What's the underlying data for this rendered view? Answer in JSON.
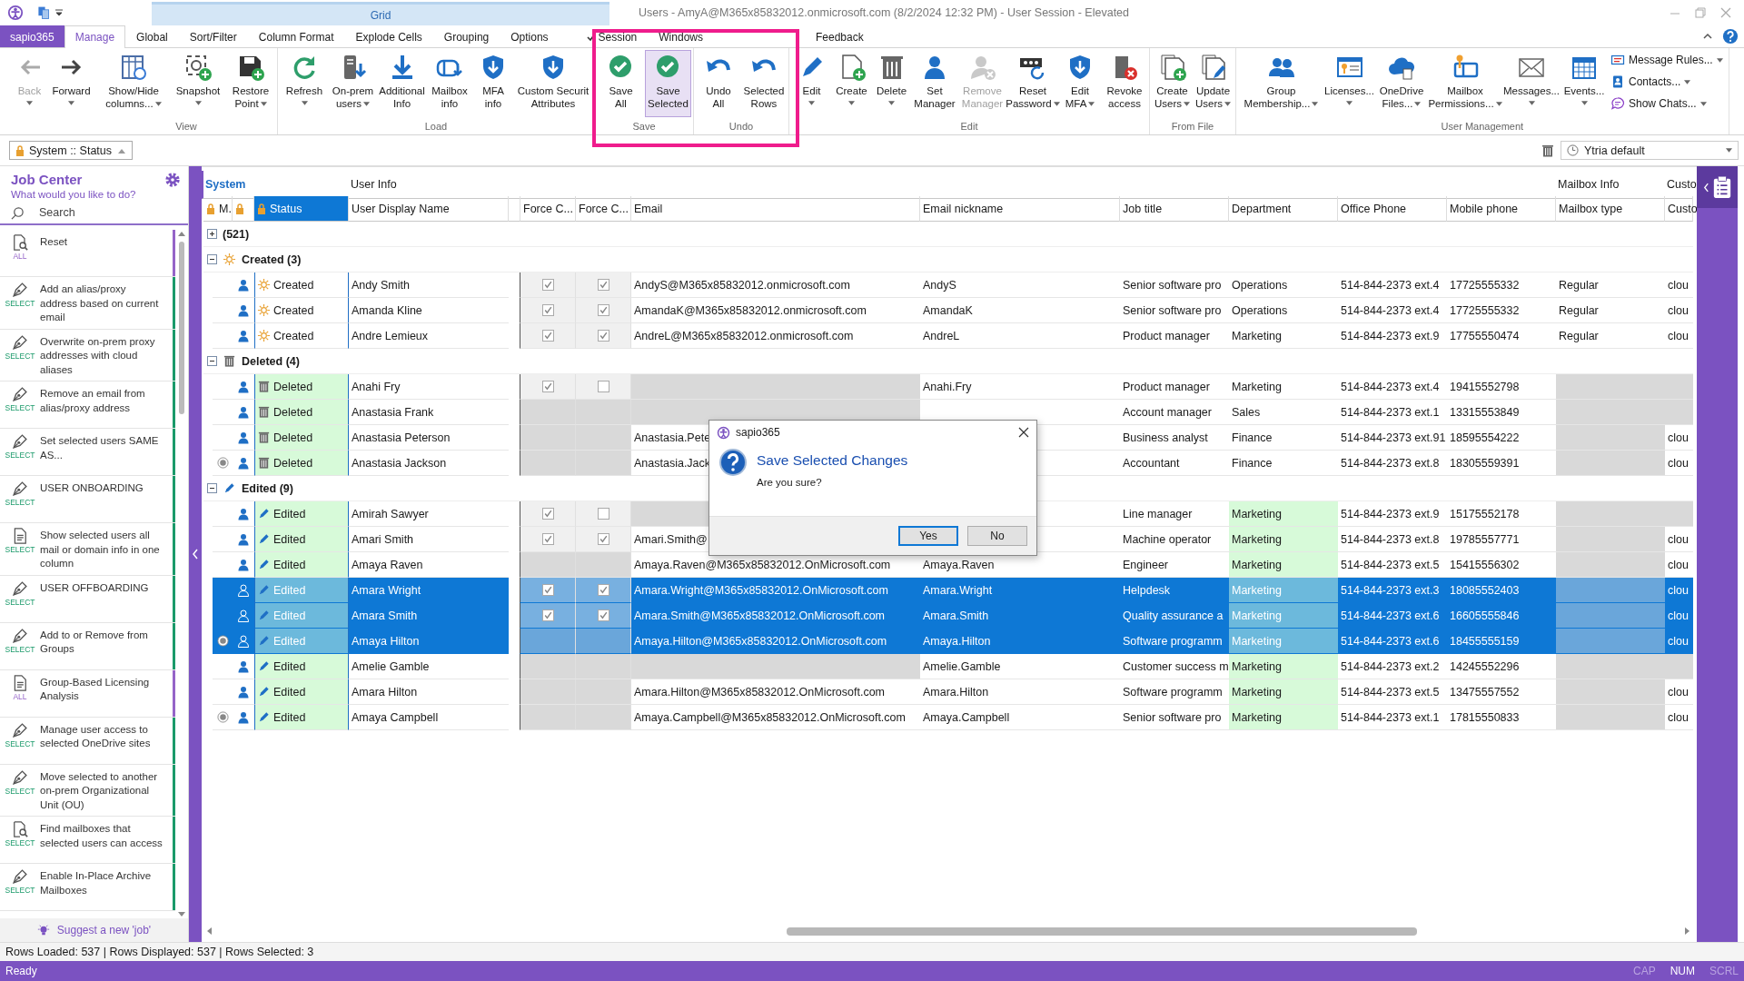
{
  "window": {
    "title": "Users - AmyA@M365x85832012.onmicrosoft.com (8/2/2024 12:32 PM) - User Session - Elevated",
    "context_tab": "Grid"
  },
  "tabs": [
    {
      "label": "sapio365",
      "kind": "app",
      "selected": false,
      "checked": false
    },
    {
      "label": "Manage",
      "kind": "tab",
      "selected": true,
      "checked": false
    },
    {
      "label": "Global",
      "kind": "tab",
      "selected": false,
      "checked": false
    },
    {
      "label": "Sort/Filter",
      "kind": "tab",
      "selected": false,
      "checked": false
    },
    {
      "label": "Column Format",
      "kind": "tab",
      "selected": false,
      "checked": false
    },
    {
      "label": "Explode Cells",
      "kind": "tab",
      "selected": false,
      "checked": false
    },
    {
      "label": "Grouping",
      "kind": "tab",
      "selected": false,
      "checked": false
    },
    {
      "label": "Options",
      "kind": "tab",
      "selected": false,
      "checked": false
    },
    {
      "label": "Session",
      "kind": "tab",
      "selected": false,
      "checked": true
    },
    {
      "label": "Windows",
      "kind": "tab",
      "selected": false,
      "checked": false
    },
    {
      "label": "Feedback",
      "kind": "tab",
      "selected": false,
      "checked": false
    }
  ],
  "highlight_frame": true,
  "ribbon": {
    "groups": [
      {
        "buttons": [
          {
            "lines": [
              "Back"
            ],
            "kind": "split",
            "disabled": true,
            "selected": false
          },
          {
            "lines": [
              "Forward"
            ],
            "kind": "split",
            "disabled": false,
            "selected": false
          }
        ]
      },
      {
        "label": "View",
        "buttons": [
          {
            "lines": [
              "Show/Hide",
              "columns..."
            ],
            "kind": "menu",
            "disabled": false,
            "selected": false
          },
          {
            "lines": [
              "Snapshot"
            ],
            "kind": "split",
            "disabled": false,
            "selected": false
          },
          {
            "lines": [
              "Restore",
              "Point"
            ],
            "kind": "menu",
            "disabled": false,
            "selected": false
          }
        ]
      },
      {
        "label": "Load",
        "buttons": [
          {
            "lines": [
              "Refresh"
            ],
            "kind": "split",
            "disabled": false,
            "selected": false
          },
          {
            "lines": [
              "On-prem",
              "users"
            ],
            "kind": "menu",
            "disabled": false,
            "selected": false
          },
          {
            "lines": [
              "Additional",
              "Info"
            ],
            "kind": "plain",
            "disabled": false,
            "selected": false
          },
          {
            "lines": [
              "Mailbox",
              "info"
            ],
            "kind": "plain",
            "disabled": false,
            "selected": false
          },
          {
            "lines": [
              "MFA",
              "info"
            ],
            "kind": "plain",
            "disabled": false,
            "selected": false
          },
          {
            "lines": [
              "Custom Securit",
              "Attributes"
            ],
            "kind": "plain",
            "disabled": false,
            "selected": false
          }
        ]
      },
      {
        "label": "Save",
        "buttons": [
          {
            "lines": [
              "Save",
              "All"
            ],
            "kind": "plain",
            "disabled": false,
            "selected": false
          },
          {
            "lines": [
              "Save",
              "Selected"
            ],
            "kind": "plain",
            "disabled": false,
            "selected": true
          }
        ]
      },
      {
        "label": "Undo",
        "buttons": [
          {
            "lines": [
              "Undo",
              "All"
            ],
            "kind": "plain",
            "disabled": false,
            "selected": false
          },
          {
            "lines": [
              "Selected",
              "Rows"
            ],
            "kind": "plain",
            "disabled": false,
            "selected": false
          }
        ]
      },
      {
        "label": "Edit",
        "buttons": [
          {
            "lines": [
              "Edit"
            ],
            "kind": "split",
            "disabled": false,
            "selected": false
          },
          {
            "lines": [
              "Create"
            ],
            "kind": "split",
            "disabled": false,
            "selected": false
          },
          {
            "lines": [
              "Delete"
            ],
            "kind": "split",
            "disabled": false,
            "selected": false
          },
          {
            "lines": [
              "Set",
              "Manager"
            ],
            "kind": "plain",
            "disabled": false,
            "selected": false
          },
          {
            "lines": [
              "Remove",
              "Manager"
            ],
            "kind": "plain",
            "disabled": true,
            "selected": false
          },
          {
            "lines": [
              "Reset",
              "Password"
            ],
            "kind": "menu",
            "disabled": false,
            "selected": false
          },
          {
            "lines": [
              "Edit",
              "MFA"
            ],
            "kind": "menu",
            "disabled": false,
            "selected": false
          },
          {
            "lines": [
              "Revoke",
              "access"
            ],
            "kind": "plain",
            "disabled": false,
            "selected": false
          }
        ]
      },
      {
        "label": "From File",
        "buttons": [
          {
            "lines": [
              "Create",
              "Users"
            ],
            "kind": "menu",
            "disabled": false,
            "selected": false
          },
          {
            "lines": [
              "Update",
              "Users"
            ],
            "kind": "menu",
            "disabled": false,
            "selected": false
          }
        ]
      },
      {
        "label": "User Management",
        "buttons": [
          {
            "lines": [
              "Group",
              "Membership..."
            ],
            "kind": "menu",
            "disabled": false,
            "selected": false
          },
          {
            "lines": [
              "Licenses..."
            ],
            "kind": "split",
            "disabled": false,
            "selected": false
          },
          {
            "lines": [
              "OneDrive",
              "Files..."
            ],
            "kind": "menu",
            "disabled": false,
            "selected": false
          },
          {
            "lines": [
              "Mailbox",
              "Permissions..."
            ],
            "kind": "menu",
            "disabled": false,
            "selected": false
          },
          {
            "lines": [
              "Messages..."
            ],
            "kind": "split",
            "disabled": false,
            "selected": false
          },
          {
            "lines": [
              "Events..."
            ],
            "kind": "split",
            "disabled": false,
            "selected": false
          }
        ],
        "small_buttons": [
          {
            "label": "Message Rules..."
          },
          {
            "label": "Contacts..."
          },
          {
            "label": "Show Chats..."
          }
        ]
      }
    ]
  },
  "view_selector": {
    "value": "System :: Status",
    "locked": true
  },
  "layout_selector": {
    "value": "Ytria default"
  },
  "job_center": {
    "title": "Job Center",
    "subtitle": "What would you like to do?",
    "search": {
      "placeholder": "Search"
    },
    "items": [
      {
        "kind": "search",
        "color": "#9564c8",
        "tag": "ALL",
        "text": "Reset"
      },
      {
        "kind": "pen",
        "color": "#1a9a6a",
        "tag": "SELECT",
        "text": "Add an alias/proxy address based on current email"
      },
      {
        "kind": "pen",
        "color": "#1a9a6a",
        "tag": "SELECT",
        "text": "Overwrite on-prem proxy addresses with cloud aliases"
      },
      {
        "kind": "pen",
        "color": "#1a9a6a",
        "tag": "SELECT",
        "text": "Remove an email from alias/proxy address"
      },
      {
        "kind": "pen",
        "color": "#1a9a6a",
        "tag": "SELECT",
        "text": "Set selected users SAME AS..."
      },
      {
        "kind": "pen",
        "color": "#1a9a6a",
        "tag": "SELECT",
        "text": "USER ONBOARDING"
      },
      {
        "kind": "document",
        "color": "#1a9a6a",
        "tag": "SELECT",
        "text": "Show selected users all mail or domain info in one column"
      },
      {
        "kind": "pen",
        "color": "#1a9a6a",
        "tag": "SELECT",
        "text": "USER OFFBOARDING"
      },
      {
        "kind": "pen",
        "color": "#1a9a6a",
        "tag": "SELECT",
        "text": "Add to or Remove from Groups"
      },
      {
        "kind": "document",
        "color": "#9564c8",
        "tag": "ALL",
        "text": "Group-Based Licensing Analysis"
      },
      {
        "kind": "pen",
        "color": "#1a9a6a",
        "tag": "SELECT",
        "text": "Manage user access to selected OneDrive sites"
      },
      {
        "kind": "pen",
        "color": "#1a9a6a",
        "tag": "SELECT",
        "text": "Move selected to another on-prem Organizational Unit (OU)"
      },
      {
        "kind": "search",
        "color": "#1a9a6a",
        "tag": "SELECT",
        "text": "Find mailboxes that selected users can access"
      },
      {
        "kind": "pen",
        "color": "#1a9a6a",
        "tag": "SELECT",
        "text": "Enable In-Place Archive Mailboxes"
      }
    ],
    "footer": "Suggest a new 'job'"
  },
  "grid": {
    "header_groups": [
      {
        "label": "System",
        "selected": true,
        "columns": [
          {
            "label": "M.",
            "locked": true,
            "selected": false
          },
          {
            "locked": true,
            "selected": false
          },
          {
            "label": "Status",
            "locked": true,
            "selected": true
          }
        ]
      },
      {
        "label": "User Info",
        "selected": false,
        "columns": [
          {
            "label": "User Display Name",
            "locked": false,
            "selected": false
          },
          {
            "label": "Force C...",
            "locked": false,
            "selected": false
          },
          {
            "label": "Force C...",
            "locked": false,
            "selected": false
          },
          {
            "label": "Email",
            "locked": false,
            "selected": false
          },
          {
            "label": "Email nickname",
            "locked": false,
            "selected": false
          },
          {
            "label": "Job title",
            "locked": false,
            "selected": false
          },
          {
            "label": "Department",
            "locked": false,
            "selected": false
          },
          {
            "label": "Office Phone",
            "locked": false,
            "selected": false
          },
          {
            "label": "Mobile phone",
            "locked": false,
            "selected": false
          }
        ]
      },
      {
        "label": "Mailbox Info",
        "selected": false,
        "columns": [
          {
            "label": "Mailbox type",
            "locked": false,
            "selected": false
          }
        ]
      },
      {
        "label": "Custo",
        "selected": false,
        "columns": [
          {
            "label": "Custo",
            "locked": false,
            "selected": false
          }
        ]
      }
    ],
    "groups": [
      {
        "label": "(521)",
        "kind": "all",
        "expanded": false
      },
      {
        "label": "Created (3)",
        "kind": "created",
        "expanded": true,
        "rows": [
          {
            "status": "Created",
            "name": "Andy Smith",
            "force_1": true,
            "force_2": true,
            "email": "AndyS@M365x85832012.onmicrosoft.com",
            "nickname": "AndyS",
            "job_title": "Senior software pro",
            "department": "Operations",
            "office_phone": "514-844-2373 ext.4",
            "mobile_phone": "17725555332",
            "mailbox_type": "Regular",
            "custo": "clou",
            "selected": false,
            "marked": false,
            "department_changed": false
          },
          {
            "status": "Created",
            "name": "Amanda Kline",
            "force_1": true,
            "force_2": true,
            "email": "AmandaK@M365x85832012.onmicrosoft.com",
            "nickname": "AmandaK",
            "job_title": "Senior software pro",
            "department": "Operations",
            "office_phone": "514-844-2373 ext.4",
            "mobile_phone": "17725555332",
            "mailbox_type": "Regular",
            "custo": "clou",
            "selected": false,
            "marked": false,
            "department_changed": false
          },
          {
            "status": "Created",
            "name": "Andre Lemieux",
            "force_1": true,
            "force_2": true,
            "email": "AndreL@M365x85832012.onmicrosoft.com",
            "nickname": "AndreL",
            "job_title": "Product manager",
            "department": "Marketing",
            "office_phone": "514-844-2373 ext.9",
            "mobile_phone": "17755550474",
            "mailbox_type": "Regular",
            "custo": "clou",
            "selected": false,
            "marked": false,
            "department_changed": false
          }
        ]
      },
      {
        "label": "Deleted (4)",
        "kind": "deleted",
        "expanded": true,
        "rows": [
          {
            "status": "Deleted",
            "name": "Anahi Fry",
            "force_1": true,
            "force_2": false,
            "nickname": "Anahi.Fry",
            "job_title": "Product manager",
            "department": "Marketing",
            "office_phone": "514-844-2373 ext.4",
            "mobile_phone": "19415552798",
            "selected": false,
            "marked": false,
            "department_changed": false
          },
          {
            "status": "Deleted",
            "name": "Anastasia Frank",
            "job_title": "Account manager",
            "department": "Sales",
            "office_phone": "514-844-2373 ext.1",
            "mobile_phone": "13315553849",
            "selected": false,
            "marked": false,
            "department_changed": false
          },
          {
            "status": "Deleted",
            "name": "Anastasia Peterson",
            "email": "Anastasia.Pete",
            "job_title": "Business analyst",
            "department": "Finance",
            "office_phone": "514-844-2373 ext.91",
            "mobile_phone": "18595554222",
            "custo": "clou",
            "selected": false,
            "marked": false,
            "department_changed": false
          },
          {
            "status": "Deleted",
            "name": "Anastasia Jackson",
            "email": "Anastasia.Jack",
            "job_title": "Accountant",
            "department": "Finance",
            "office_phone": "514-844-2373 ext.8",
            "mobile_phone": "18305559391",
            "custo": "clou",
            "selected": false,
            "marked": true,
            "department_changed": false
          }
        ]
      },
      {
        "label": "Edited (9)",
        "kind": "edited",
        "expanded": true,
        "rows": [
          {
            "status": "Edited",
            "name": "Amirah Sawyer",
            "force_1": true,
            "force_2": false,
            "job_title": "Line manager",
            "department": "Marketing",
            "office_phone": "514-844-2373 ext.9",
            "mobile_phone": "15175552178",
            "selected": false,
            "marked": false,
            "department_changed": true
          },
          {
            "status": "Edited",
            "name": "Amari Smith",
            "force_1": true,
            "force_2": true,
            "email": "Amari.Smith@",
            "job_title": "Machine operator",
            "department": "Marketing",
            "office_phone": "514-844-2373 ext.8",
            "mobile_phone": "19785557771",
            "custo": "clou",
            "selected": false,
            "marked": false,
            "department_changed": true
          },
          {
            "status": "Edited",
            "name": "Amaya Raven",
            "email": "Amaya.Raven@M365x85832012.OnMicrosoft.com",
            "nickname": "Amaya.Raven",
            "job_title": "Engineer",
            "department": "Marketing",
            "office_phone": "514-844-2373 ext.5",
            "mobile_phone": "15415556302",
            "custo": "clou",
            "selected": false,
            "marked": false,
            "department_changed": true
          },
          {
            "status": "Edited",
            "name": "Amara Wright",
            "force_1": true,
            "force_2": true,
            "email": "Amara.Wright@M365x85832012.OnMicrosoft.com",
            "nickname": "Amara.Wright",
            "job_title": "Helpdesk",
            "department": "Marketing",
            "office_phone": "514-844-2373 ext.3",
            "mobile_phone": "18085552403",
            "custo": "clou",
            "selected": true,
            "marked": false,
            "department_changed": true
          },
          {
            "status": "Edited",
            "name": "Amara Smith",
            "force_1": true,
            "force_2": true,
            "email": "Amara.Smith@M365x85832012.OnMicrosoft.com",
            "nickname": "Amara.Smith",
            "job_title": "Quality assurance a",
            "department": "Marketing",
            "office_phone": "514-844-2373 ext.6",
            "mobile_phone": "16605555846",
            "custo": "clou",
            "selected": true,
            "marked": false,
            "department_changed": true
          },
          {
            "status": "Edited",
            "name": "Amaya Hilton",
            "email": "Amaya.Hilton@M365x85832012.OnMicrosoft.com",
            "nickname": "Amaya.Hilton",
            "job_title": "Software programm",
            "department": "Marketing",
            "office_phone": "514-844-2373 ext.6",
            "mobile_phone": "18455555159",
            "custo": "clou",
            "selected": true,
            "marked": true,
            "department_changed": true
          },
          {
            "status": "Edited",
            "name": "Amelie Gamble",
            "nickname": "Amelie.Gamble",
            "job_title": "Customer success m",
            "department": "Marketing",
            "office_phone": "514-844-2373 ext.2",
            "mobile_phone": "14245552296",
            "selected": false,
            "marked": false,
            "department_changed": true
          },
          {
            "status": "Edited",
            "name": "Amara Hilton",
            "email": "Amara.Hilton@M365x85832012.OnMicrosoft.com",
            "nickname": "Amara.Hilton",
            "job_title": "Software programm",
            "department": "Marketing",
            "office_phone": "514-844-2373 ext.5",
            "mobile_phone": "13475557552",
            "custo": "clou",
            "selected": false,
            "marked": false,
            "department_changed": true
          },
          {
            "status": "Edited",
            "name": "Amaya Campbell",
            "email": "Amaya.Campbell@M365x85832012.OnMicrosoft.com",
            "nickname": "Amaya.Campbell",
            "job_title": "Senior software pro",
            "department": "Marketing",
            "office_phone": "514-844-2373 ext.1",
            "mobile_phone": "17815550833",
            "custo": "clou",
            "selected": false,
            "marked": true,
            "department_changed": true
          }
        ]
      }
    ]
  },
  "dialog": {
    "app": "sapio365",
    "title": "Save Selected Changes",
    "message": "Are you sure?",
    "buttons": [
      {
        "label": "Yes",
        "selected": true
      },
      {
        "label": "No",
        "selected": false
      }
    ]
  },
  "status_bar": {
    "rows_info": "Rows Loaded: 537 | Rows Displayed: 537 | Rows Selected: 3",
    "status": "Ready",
    "indicators": [
      {
        "label": "CAP",
        "on": false
      },
      {
        "label": "NUM",
        "on": true
      },
      {
        "label": "SCRL",
        "on": false
      }
    ]
  }
}
